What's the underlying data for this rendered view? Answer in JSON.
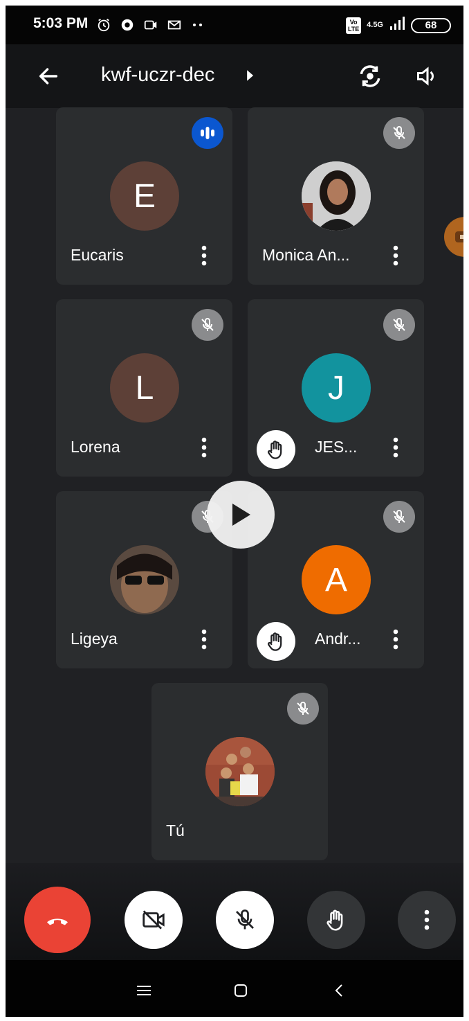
{
  "status_bar": {
    "time": "5:03 PM",
    "icons": [
      "alarm-icon",
      "photos-icon",
      "video-icon",
      "gmail-icon",
      "more-dots-icon"
    ],
    "volte": "Vo LTE",
    "network": "4.5G",
    "battery": "68"
  },
  "header": {
    "meeting_code": "kwf-uczr-dec"
  },
  "participants": [
    {
      "name": "Eucaris",
      "initial": "E",
      "avatar_color": "#5d4037",
      "status": "speaking",
      "hand_raised": false
    },
    {
      "name": "Monica An...",
      "initial": "",
      "avatar_color": "#d9d9d9",
      "status": "muted",
      "hand_raised": false,
      "photo": true
    },
    {
      "name": "Lorena",
      "initial": "L",
      "avatar_color": "#5d4037",
      "status": "muted",
      "hand_raised": false
    },
    {
      "name": "JES...",
      "initial": "J",
      "avatar_color": "#12939e",
      "status": "muted",
      "hand_raised": true
    },
    {
      "name": "Ligeya",
      "initial": "",
      "avatar_color": "#3e2f2a",
      "status": "muted",
      "hand_raised": false,
      "photo": true
    },
    {
      "name": "Andr...",
      "initial": "A",
      "avatar_color": "#ef6c00",
      "status": "muted",
      "hand_raised": true
    },
    {
      "name": "Tú",
      "initial": "",
      "avatar_color": "#8a4b35",
      "status": "muted",
      "hand_raised": false,
      "photo": true
    }
  ],
  "controls": {
    "end_call_color": "#ea4335",
    "buttons": [
      "end-call",
      "camera-off",
      "mic-off",
      "raise-hand",
      "more-options"
    ]
  },
  "colors": {
    "background": "#202124",
    "tile": "#2b2d2f",
    "speaking": "#0b57d0"
  }
}
